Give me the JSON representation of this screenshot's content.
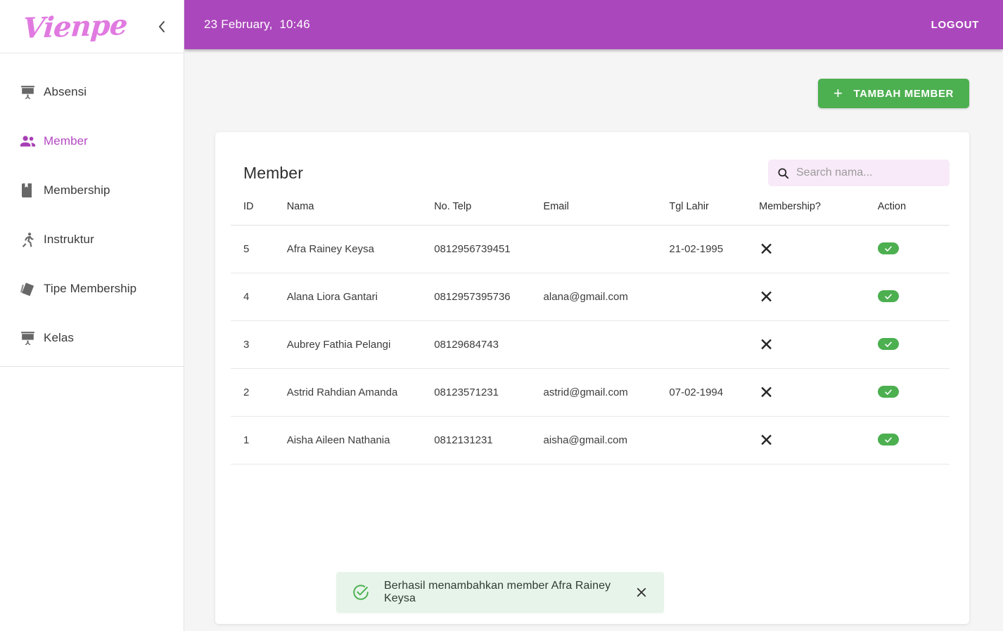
{
  "brand": {
    "logo_text": "Vienpe",
    "logo_color": "#e07ae0",
    "collapse_icon": "chevron-left-icon"
  },
  "sidebar": {
    "items": [
      {
        "label": "Absensi",
        "icon": "presentation-board-icon",
        "active": false
      },
      {
        "label": "Member",
        "icon": "people-icon",
        "active": true
      },
      {
        "label": "Membership",
        "icon": "bookmark-book-icon",
        "active": false
      },
      {
        "label": "Instruktur",
        "icon": "running-person-icon",
        "active": false
      },
      {
        "label": "Tipe Membership",
        "icon": "cards-stack-icon",
        "active": false
      },
      {
        "label": "Kelas",
        "icon": "presentation-board-icon",
        "active": false
      }
    ],
    "active_color": "#b549c4"
  },
  "topbar": {
    "date_time": "23 February,  10:46",
    "logout_label": "LOGOUT",
    "background": "#ab47bc"
  },
  "toolbar": {
    "add_member_label": "TAMBAH MEMBER",
    "add_member_plus": "+",
    "add_button_color": "#4caf50"
  },
  "card": {
    "title": "Member",
    "search": {
      "placeholder": "Search nama...",
      "value": "",
      "icon": "search-icon"
    }
  },
  "table": {
    "columns": [
      "ID",
      "Nama",
      "No. Telp",
      "Email",
      "Tgl Lahir",
      "Membership?",
      "Action"
    ],
    "rows": [
      {
        "id": "5",
        "nama": "Afra Rainey Keysa",
        "telp": "0812956739451",
        "email": "",
        "tgl_lahir": "21-02-1995",
        "membership": "✕",
        "action": "toggle-on"
      },
      {
        "id": "4",
        "nama": "Alana Liora Gantari",
        "telp": "0812957395736",
        "email": "alana@gmail.com",
        "tgl_lahir": "",
        "membership": "✕",
        "action": "toggle-on"
      },
      {
        "id": "3",
        "nama": "Aubrey Fathia Pelangi",
        "telp": "08129684743",
        "email": "",
        "tgl_lahir": "",
        "membership": "✕",
        "action": "toggle-on"
      },
      {
        "id": "2",
        "nama": "Astrid Rahdian Amanda",
        "telp": "08123571231",
        "email": "astrid@gmail.com",
        "tgl_lahir": "07-02-1994",
        "membership": "✕",
        "action": "toggle-on"
      },
      {
        "id": "1",
        "nama": "Aisha Aileen Nathania",
        "telp": "0812131231",
        "email": "aisha@gmail.com",
        "tgl_lahir": "",
        "membership": "✕",
        "action": "toggle-on"
      }
    ]
  },
  "toast": {
    "message": "Berhasil menambahkan member Afra Rainey Keysa",
    "icon": "check-circle-icon",
    "close_icon": "close-icon",
    "background": "#e7f4e9",
    "accent": "#4caf50"
  }
}
